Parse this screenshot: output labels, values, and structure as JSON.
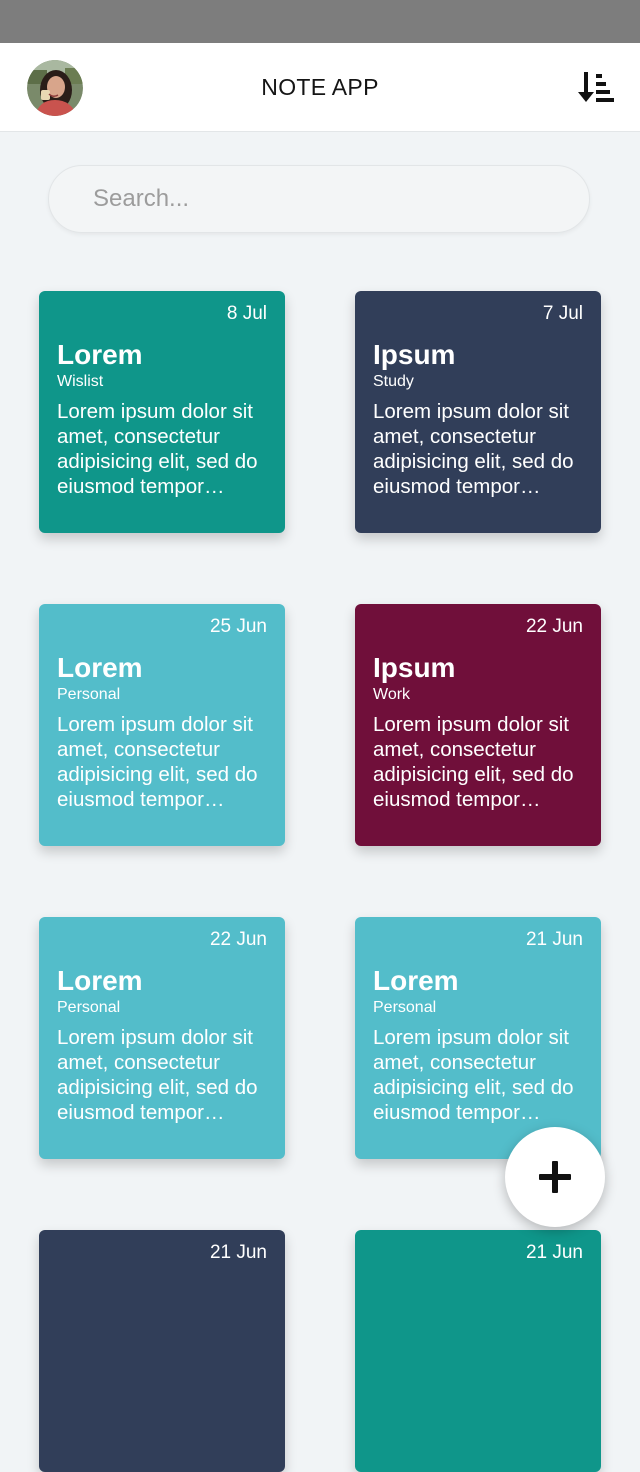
{
  "header": {
    "title": "NOTE APP",
    "avatar_icon": "user-avatar",
    "sort_icon": "sort-descending-icon"
  },
  "search": {
    "placeholder": "Search...",
    "value": ""
  },
  "colors": {
    "teal": "#0f968a",
    "navy": "#313e59",
    "cyan": "#53bdca",
    "maroon": "#700f3a",
    "background": "#f1f4f6"
  },
  "notes": [
    {
      "date": "8 Jul",
      "title": "Lorem",
      "category": "Wislist",
      "body": "Lorem ipsum dolor sit amet, consectetur adipisicing elit, sed do eiusmod tempor incididunt",
      "color": "#0f968a"
    },
    {
      "date": "7 Jul",
      "title": "Ipsum",
      "category": "Study",
      "body": "Lorem ipsum dolor sit amet, consectetur adipisicing elit, sed do eiusmod tempor incididunt",
      "color": "#313e59"
    },
    {
      "date": "25 Jun",
      "title": "Lorem",
      "category": "Personal",
      "body": "Lorem ipsum dolor sit amet, consectetur adipisicing elit, sed do eiusmod tempor incididunt",
      "color": "#53bdca"
    },
    {
      "date": "22 Jun",
      "title": "Ipsum",
      "category": "Work",
      "body": "Lorem ipsum dolor sit amet, consectetur adipisicing elit, sed do eiusmod tempor incididunt",
      "color": "#700f3a"
    },
    {
      "date": "22 Jun",
      "title": "Lorem",
      "category": "Personal",
      "body": "Lorem ipsum dolor sit amet, consectetur adipisicing elit, sed do eiusmod tempor incididunt",
      "color": "#53bdca"
    },
    {
      "date": "21 Jun",
      "title": "Lorem",
      "category": "Personal",
      "body": "Lorem ipsum dolor sit amet, consectetur adipisicing elit, sed do eiusmod tempor incididunt",
      "color": "#53bdca"
    },
    {
      "date": "21 Jun",
      "title": "",
      "category": "",
      "body": "",
      "color": "#313e59"
    },
    {
      "date": "21 Jun",
      "title": "",
      "category": "",
      "body": "",
      "color": "#0f968a"
    }
  ],
  "fab": {
    "icon": "plus-icon"
  }
}
